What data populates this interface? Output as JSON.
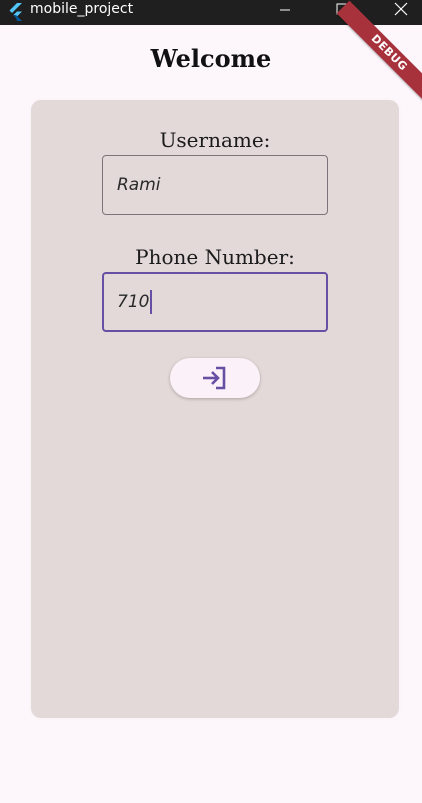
{
  "window": {
    "title": "mobile_project",
    "app_icon": "flutter-icon",
    "controls": [
      "minimize-icon",
      "maximize-icon",
      "close-icon"
    ]
  },
  "debug_banner": "DEBUG",
  "page": {
    "title": "Welcome"
  },
  "form": {
    "username_label": "Username:",
    "username_value": "Rami",
    "phone_label": "Phone Number:",
    "phone_value": "710",
    "submit_icon": "login-icon"
  },
  "colors": {
    "accent": "#6750a4",
    "card": "#e3d9d8",
    "background": "#fdf7fc",
    "debug": "#a8323c"
  }
}
